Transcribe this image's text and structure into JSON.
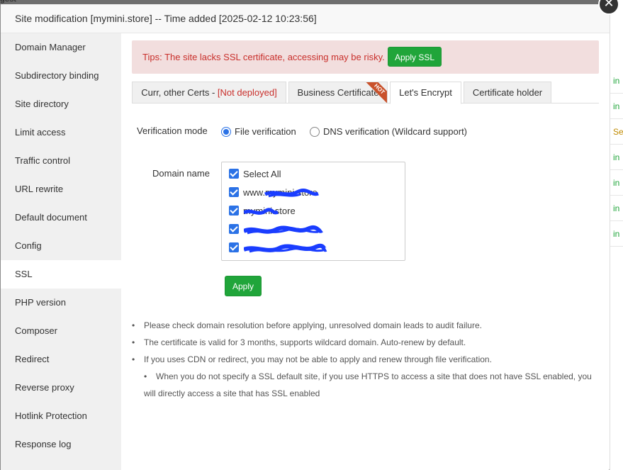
{
  "background": {
    "partial_text": "gest",
    "right_strip_items": [
      "in",
      "in",
      "Se",
      "in",
      "in",
      "in",
      "in"
    ]
  },
  "dialog": {
    "title": "Site modification [mymini.store] -- Time added [2025-02-12 10:23:56]",
    "close_glyph": "✕"
  },
  "sidebar": {
    "items": [
      {
        "label": "Domain Manager"
      },
      {
        "label": "Subdirectory binding"
      },
      {
        "label": "Site directory"
      },
      {
        "label": "Limit access"
      },
      {
        "label": "Traffic control"
      },
      {
        "label": "URL rewrite"
      },
      {
        "label": "Default document"
      },
      {
        "label": "Config"
      },
      {
        "label": "SSL"
      },
      {
        "label": "PHP version"
      },
      {
        "label": "Composer"
      },
      {
        "label": "Redirect"
      },
      {
        "label": "Reverse proxy"
      },
      {
        "label": "Hotlink Protection"
      },
      {
        "label": "Response log"
      }
    ],
    "active": "SSL"
  },
  "tips": {
    "text": "Tips: The site lacks SSL certificate, accessing may be risky.",
    "button": "Apply SSL"
  },
  "tabs": {
    "curr_certs_prefix": "Curr, other Certs - ",
    "curr_certs_status": "[Not deployed]",
    "business": "Business Certificate",
    "hot_badge": "HOT",
    "letsencrypt": "Let's Encrypt",
    "holder": "Certificate holder",
    "active": "Let's Encrypt"
  },
  "verification": {
    "label": "Verification mode",
    "options": [
      "File verification",
      "DNS verification (Wildcard support)"
    ],
    "selected": "File verification"
  },
  "domains": {
    "label": "Domain name",
    "select_all": "Select All",
    "items": [
      "www.mymini.store",
      "mymini.store",
      "",
      ""
    ]
  },
  "apply_button": "Apply",
  "notes": [
    "Please check domain resolution before applying, unresolved domain leads to audit failure.",
    "The certificate is valid for 3 months, supports wildcard domain. Auto-renew by default.",
    "If you uses CDN or redirect, you may not be able to apply and renew through file verification.",
    "When you do not specify a SSL default site, if you use HTTPS to access a site that does not have SSL enabled, you will directly access a site that has SSL enabled"
  ],
  "colors": {
    "accent_green": "#20a53a",
    "warning_red": "#c9302c",
    "checkbox_blue": "#2b72e6",
    "redaction_blue": "#1a3dff"
  }
}
